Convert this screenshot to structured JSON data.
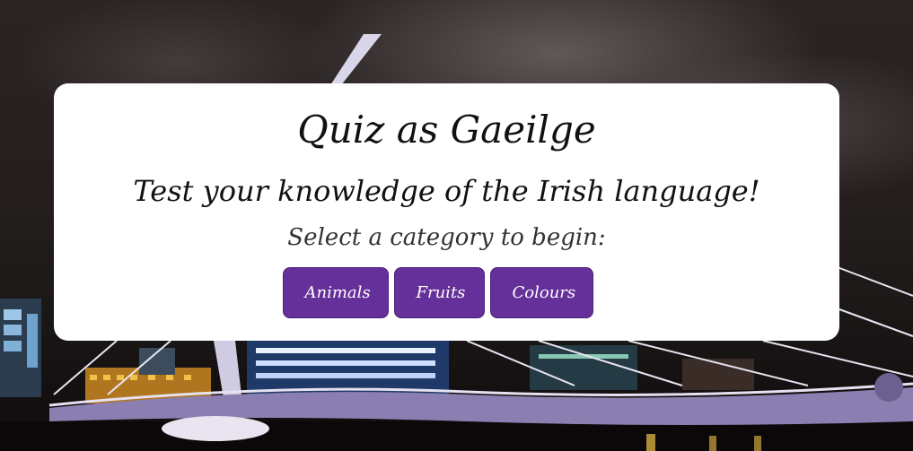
{
  "background": {
    "description_icon": "bridge-night-photo",
    "sky_color": "#241e1e",
    "bridge_color": "#8a7fb0"
  },
  "card": {
    "title": "Quiz as Gaeilge",
    "subtitle": "Test your knowledge of the Irish language!",
    "prompt": "Select a category to begin:"
  },
  "categories": {
    "animals": "Animals",
    "fruits": "Fruits",
    "colours": "Colours"
  },
  "colors": {
    "button": "#66309a",
    "card": "#ffffff"
  }
}
